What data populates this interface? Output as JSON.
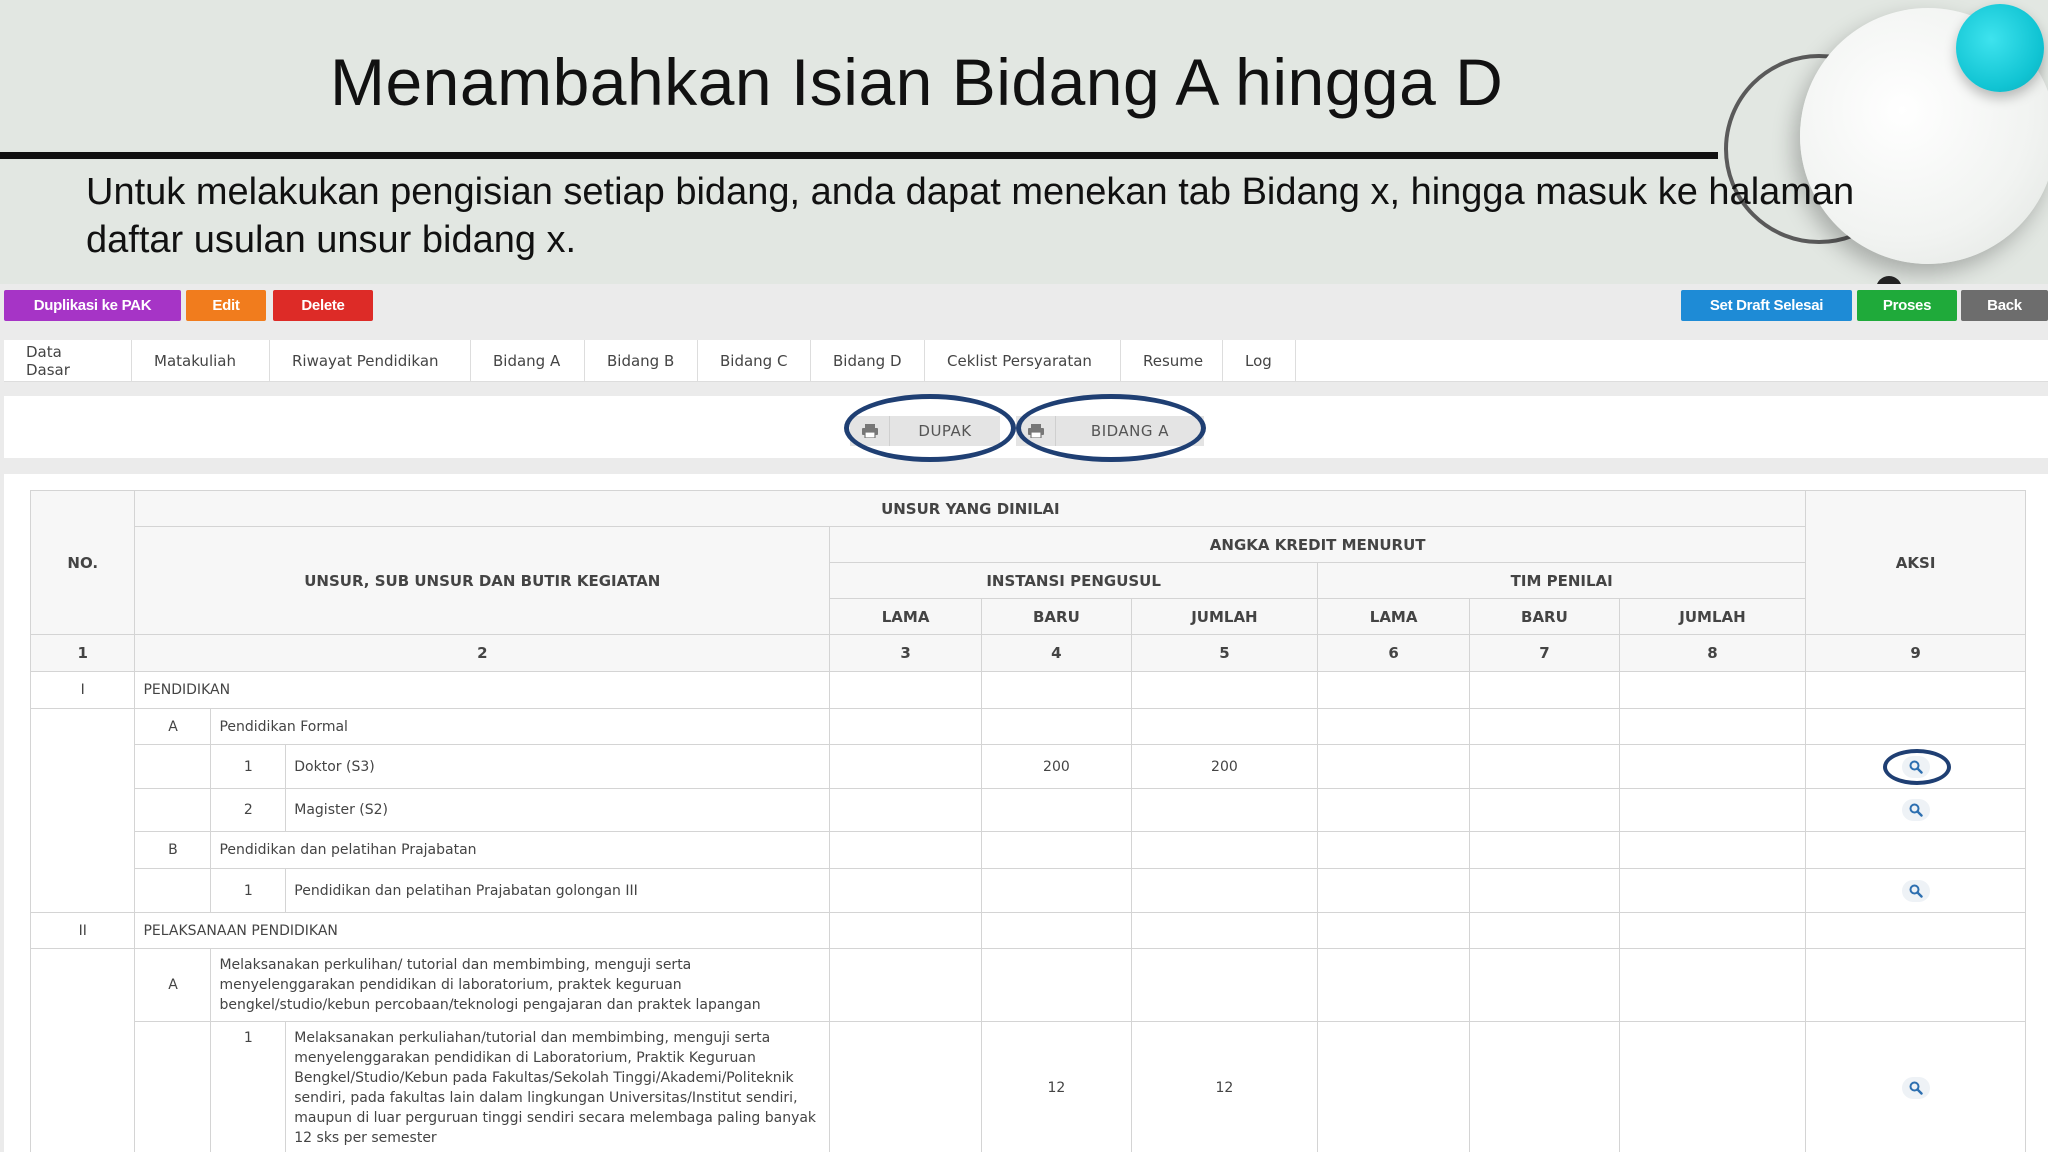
{
  "slide": {
    "title": "Menambahkan Isian Bidang A hingga D",
    "description": "Untuk melakukan pengisian setiap bidang, anda dapat menekan tab Bidang x, hingga masuk ke halaman daftar usulan unsur bidang x."
  },
  "colors": {
    "purple": "#a634c6",
    "orange": "#f17c1d",
    "red": "#dd2b27",
    "blue": "#1e8bd6",
    "green": "#1faa3a",
    "gray": "#6d6d6d",
    "highlight": "#1f3f73"
  },
  "toolbar": {
    "duplicate": "Duplikasi ke PAK",
    "edit": "Edit",
    "delete": "Delete",
    "set_draft": "Set Draft Selesai",
    "process": "Proses",
    "back": "Back"
  },
  "tabs": [
    "Data Dasar",
    "Matakuliah",
    "Riwayat Pendidikan",
    "Bidang A",
    "Bidang B",
    "Bidang C",
    "Bidang D",
    "Ceklist Persyaratan",
    "Resume",
    "Log"
  ],
  "print": {
    "dupak": "DUPAK",
    "bidang_a": "BIDANG A",
    "icon": "printer-icon"
  },
  "table": {
    "head": {
      "no": "NO.",
      "unsur_dinilai": "UNSUR YANG DINILAI",
      "unsur_sub": "UNSUR, SUB UNSUR DAN BUTIR KEGIATAN",
      "angka_kredit": "ANGKA KREDIT MENURUT",
      "instansi": "INSTANSI PENGUSUL",
      "tim": "TIM PENILAI",
      "aksi": "AKSI",
      "lama": "LAMA",
      "baru": "BARU",
      "jumlah": "JUMLAH",
      "nums": [
        "1",
        "2",
        "3",
        "4",
        "5",
        "6",
        "7",
        "8",
        "9"
      ]
    },
    "rows": {
      "r1_no": "I",
      "r1_label": "PENDIDIKAN",
      "r1a_no": "A",
      "r1a_label": "Pendidikan Formal",
      "r1a1_no": "1",
      "r1a1_label": "Doktor (S3)",
      "r1a1_baru": "200",
      "r1a1_jumlah": "200",
      "r1a2_no": "2",
      "r1a2_label": "Magister (S2)",
      "r1b_no": "B",
      "r1b_label": "Pendidikan dan pelatihan Prajabatan",
      "r1b1_no": "1",
      "r1b1_label": "Pendidikan dan pelatihan Prajabatan golongan III",
      "r2_no": "II",
      "r2_label": "PELAKSANAAN PENDIDIKAN",
      "r2a_no": "A",
      "r2a_label": "Melaksanakan perkulihan/ tutorial dan membimbing, menguji serta menyelenggarakan pendidikan di laboratorium, praktek keguruan bengkel/studio/kebun percobaan/teknologi pengajaran dan praktek lapangan",
      "r2a1_no": "1",
      "r2a1_label": "Melaksanakan perkuliahan/tutorial dan membimbing, menguji serta menyelenggarakan pendidikan di Laboratorium, Praktik Keguruan Bengkel/Studio/Kebun pada Fakultas/Sekolah Tinggi/Akademi/Politeknik sendiri, pada fakultas lain dalam lingkungan Universitas/Institut sendiri, maupun di luar perguruan tinggi sendiri secara melembaga paling banyak 12 sks per semester",
      "r2a1_baru": "12",
      "r2a1_jumlah": "12"
    }
  }
}
